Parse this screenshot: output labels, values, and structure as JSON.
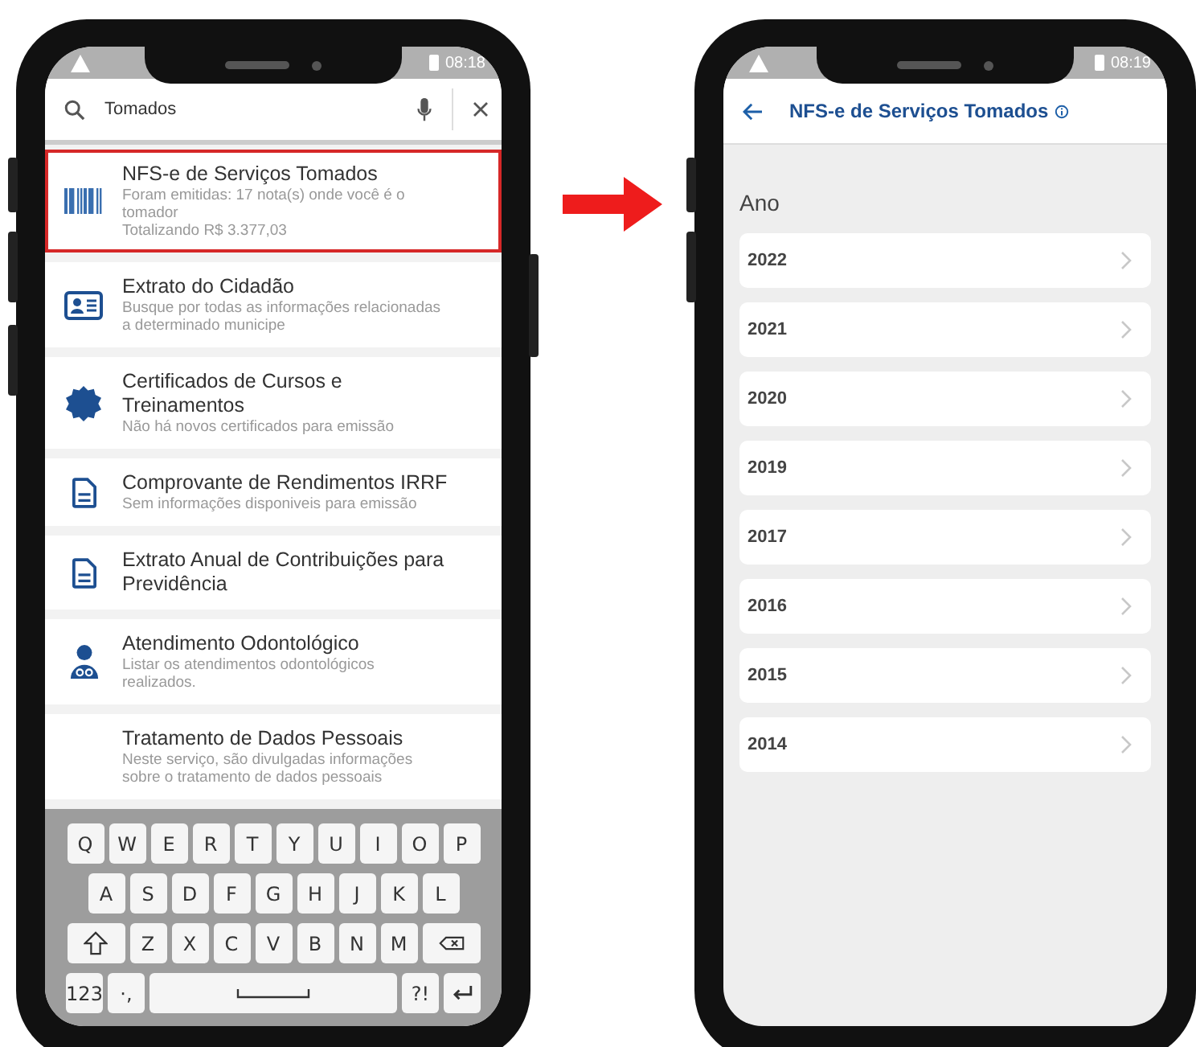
{
  "left_phone": {
    "status_bar": {
      "time": "08:18"
    },
    "search": {
      "value": "Tomados"
    },
    "services": [
      {
        "kind": "barcode",
        "highlighted": true,
        "title": "NFS-e de Serviços Tomados",
        "lines": [
          "Foram emitidas: 17 nota(s) onde você é o tomador",
          "Totalizando R$ 3.377,03"
        ]
      },
      {
        "kind": "idcard",
        "highlighted": false,
        "title": "Extrato do Cidadão",
        "lines": [
          "Busque por todas as informações relacionadas a determinado municipe"
        ]
      },
      {
        "kind": "badge",
        "highlighted": false,
        "title": "Certificados de Cursos e Treinamentos",
        "lines": [
          "Não há novos certificados para emissão"
        ]
      },
      {
        "kind": "document",
        "highlighted": false,
        "title": "Comprovante de Rendimentos IRRF",
        "lines": [
          "Sem informações disponiveis para emissão"
        ]
      },
      {
        "kind": "document",
        "highlighted": false,
        "title": "Extrato Anual de Contribuições para Previdência"
      },
      {
        "kind": "dentist",
        "highlighted": false,
        "title": "Atendimento Odontológico",
        "lines": [
          "Listar os atendimentos odontológicos realizados."
        ]
      },
      {
        "kind": "plain",
        "highlighted": false,
        "title": "Tratamento de Dados Pessoais",
        "lines": [
          "Neste serviço, são divulgadas informações sobre o tratamento de dados pessoais"
        ]
      }
    ],
    "keyboard": [
      [
        {
          "kind": "letter",
          "label": "Q"
        },
        {
          "kind": "letter",
          "label": "W"
        },
        {
          "kind": "letter",
          "label": "E"
        },
        {
          "kind": "letter",
          "label": "R"
        },
        {
          "kind": "letter",
          "label": "T"
        },
        {
          "kind": "letter",
          "label": "Y"
        },
        {
          "kind": "letter",
          "label": "U"
        },
        {
          "kind": "letter",
          "label": "I"
        },
        {
          "kind": "letter",
          "label": "O"
        },
        {
          "kind": "letter",
          "label": "P"
        }
      ],
      [
        {
          "kind": "letter",
          "label": "A"
        },
        {
          "kind": "letter",
          "label": "S"
        },
        {
          "kind": "letter",
          "label": "D"
        },
        {
          "kind": "letter",
          "label": "F"
        },
        {
          "kind": "letter",
          "label": "G"
        },
        {
          "kind": "letter",
          "label": "H"
        },
        {
          "kind": "letter",
          "label": "J"
        },
        {
          "kind": "letter",
          "label": "K"
        },
        {
          "kind": "letter",
          "label": "L"
        }
      ],
      [
        {
          "kind": "shift"
        },
        {
          "kind": "letter",
          "label": "Z"
        },
        {
          "kind": "letter",
          "label": "X"
        },
        {
          "kind": "letter",
          "label": "C"
        },
        {
          "kind": "letter",
          "label": "V"
        },
        {
          "kind": "letter",
          "label": "B"
        },
        {
          "kind": "letter",
          "label": "N"
        },
        {
          "kind": "letter",
          "label": "M"
        },
        {
          "kind": "backspace"
        }
      ],
      [
        {
          "kind": "letter",
          "label": "123"
        },
        {
          "kind": "letter",
          "label": "·,"
        },
        {
          "kind": "space"
        },
        {
          "kind": "letter",
          "label": "?!"
        },
        {
          "kind": "enter"
        }
      ]
    ]
  },
  "right_phone": {
    "status_bar": {
      "time": "08:19"
    },
    "title": "NFS-e de Serviços Tomados",
    "section_label": "Ano",
    "years": [
      "2022",
      "2021",
      "2020",
      "2019",
      "2017",
      "2016",
      "2015",
      "2014"
    ]
  }
}
